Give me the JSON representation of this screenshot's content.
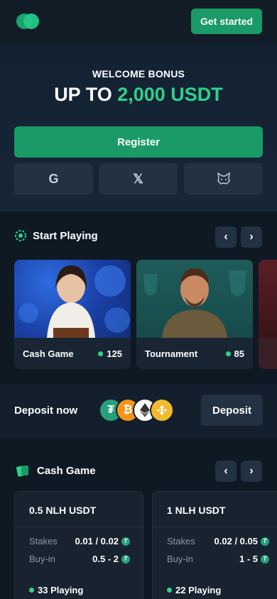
{
  "header": {
    "cta_label": "Get started"
  },
  "hero": {
    "welcome": "WELCOME BONUS",
    "upto_prefix": "UP TO ",
    "upto_amount": "2,000 USDT",
    "register_label": "Register",
    "social": [
      {
        "icon": "google-icon",
        "glyph": "G"
      },
      {
        "icon": "x-icon",
        "glyph": "𝕏"
      },
      {
        "icon": "metamask-icon",
        "glyph": ""
      }
    ]
  },
  "start_playing": {
    "title": "Start Playing",
    "prev": "‹",
    "next": "›",
    "cards": [
      {
        "label": "Cash Game",
        "count": "125"
      },
      {
        "label": "Tournament",
        "count": "85"
      }
    ]
  },
  "deposit": {
    "text": "Deposit now",
    "button": "Deposit",
    "coins": [
      {
        "icon": "tether-icon",
        "glyph": "₮",
        "color": "#26a17b"
      },
      {
        "icon": "bitcoin-icon",
        "glyph": "₿",
        "color": "#f7931a"
      },
      {
        "icon": "ethereum-icon",
        "glyph": "◆",
        "color": "#ffffff"
      },
      {
        "icon": "bnb-icon",
        "glyph": "◈",
        "color": "#f3ba2f"
      }
    ]
  },
  "cash_game": {
    "title": "Cash Game",
    "prev": "‹",
    "next": "›",
    "stakes_label": "Stakes",
    "buyin_label": "Buy-in",
    "tables": [
      {
        "name": "0.5 NLH USDT",
        "stakes": "0.01 / 0.02",
        "buyin": "0.5 - 2",
        "playing": "33 Playing"
      },
      {
        "name": "1 NLH USDT",
        "stakes": "0.02 / 0.05",
        "buyin": "1 - 5",
        "playing": "22 Playing"
      }
    ]
  },
  "colors": {
    "accent": "#1a9a67",
    "accent_text": "#2fd18a",
    "bg": "#0f1924",
    "panel": "#223242"
  }
}
